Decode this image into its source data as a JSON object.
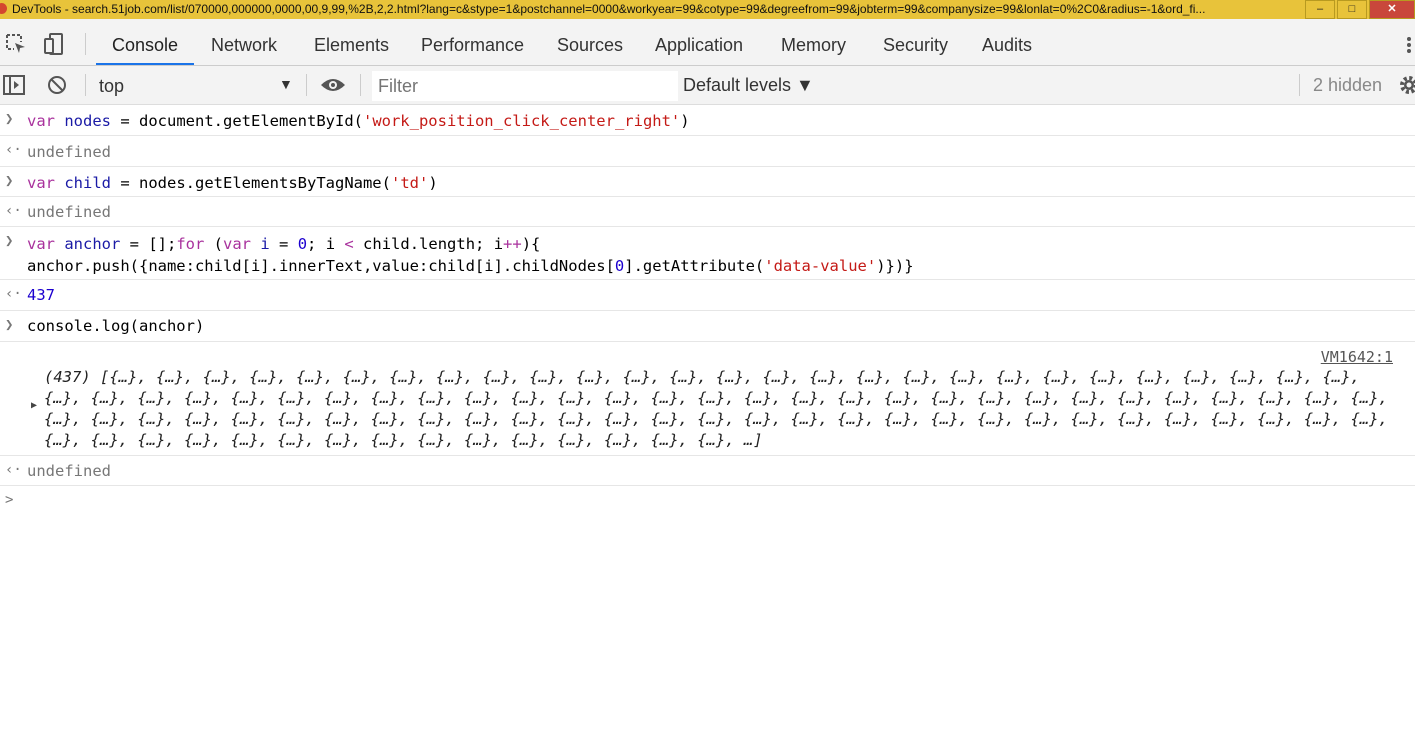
{
  "window": {
    "title": "DevTools - search.51job.com/list/070000,000000,0000,00,9,99,%2B,2,2.html?lang=c&stype=1&postchannel=0000&workyear=99&cotype=99&degreefrom=99&jobterm=99&companysize=99&lonlat=0%2C0&radius=-1&ord_fi...",
    "minimize": "–",
    "maximize": "□",
    "close": "✕"
  },
  "tabs": [
    "Console",
    "Network",
    "Elements",
    "Performance",
    "Sources",
    "Application",
    "Memory",
    "Security",
    "Audits"
  ],
  "toolbar": {
    "context": "top",
    "context_arrow": "▼",
    "filter_placeholder": "Filter",
    "levels": "Default levels ▼",
    "hidden": "2 hidden"
  },
  "console": {
    "cmd1": {
      "kw": "var",
      "name": "nodes",
      "op": " = ",
      "call": "document.getElementById(",
      "arg": "'work_position_click_center_right'",
      "end": ")"
    },
    "res1": "undefined",
    "cmd2": {
      "kw": "var",
      "name": "child",
      "op": " = ",
      "call": "nodes.getElementsByTagName(",
      "arg": "'td'",
      "end": ")"
    },
    "res2": "undefined",
    "cmd3": {
      "kw": "var",
      "name": "anchor",
      "op": " = [];",
      "kw2": "for",
      "p1": " (",
      "kw3": "var",
      "name2": "i",
      "op2": " = ",
      "zero": "0",
      "rest": "; i ",
      "lt": "<",
      "rest2": " child.length; i",
      "pp": "++",
      "rest3": "){",
      "line2a": "anchor.push({name:child[i].innerText,value:child[i].childNodes[",
      "idx": "0",
      "line2b": "].getAttribute(",
      "attr": "'data-value'",
      "line2c": ")})}"
    },
    "res3": "437",
    "cmd4": "console.log(anchor)",
    "log_source": "VM1642:1",
    "log_output": "(437) [{…}, {…}, {…}, {…}, {…}, {…}, {…}, {…}, {…}, {…}, {…}, {…}, {…}, {…}, {…}, {…}, {…}, {…}, {…}, {…}, {…}, {…}, {…}, {…}, {…}, {…}, {…}, {…}, {…}, {…}, {…}, {…}, {…}, {…}, {…}, {…}, {…}, {…}, {…}, {…}, {…}, {…}, {…}, {…}, {…}, {…}, {…}, {…}, {…}, {…}, {…}, {…}, {…}, {…}, {…}, {…}, {…}, {…}, {…}, {…}, {…}, {…}, {…}, {…}, {…}, {…}, {…}, {…}, {…}, {…}, {…}, {…}, {…}, {…}, {…}, {…}, {…}, {…}, {…}, {…}, {…}, {…}, {…}, {…}, {…}, {…}, {…}, {…}, {…}, {…}, {…}, {…}, {…}, {…}, {…}, {…}, {…}, {…}, {…}, {…}, …]",
    "res4": "undefined",
    "prompt": ">"
  }
}
